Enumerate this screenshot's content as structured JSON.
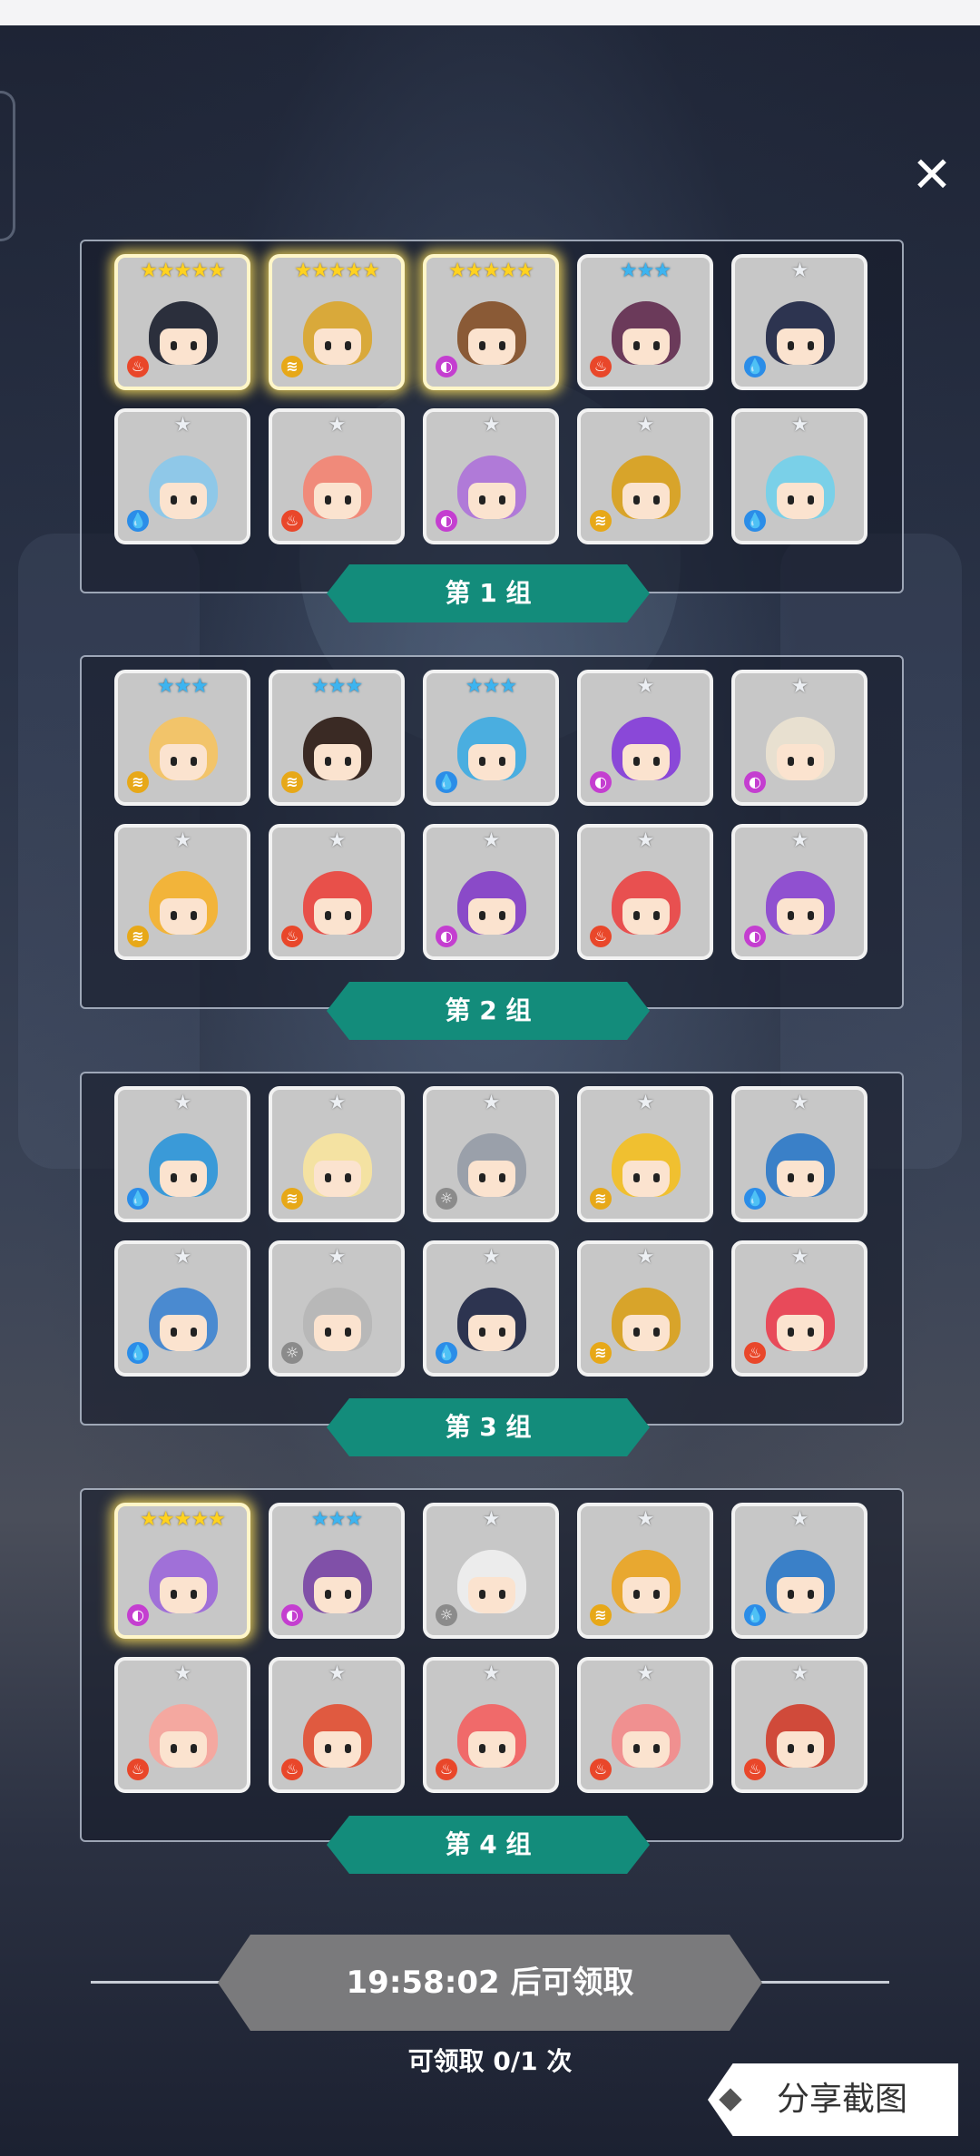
{
  "close_glyph": "✕",
  "groups": [
    {
      "label": "第 1 组",
      "cards": [
        {
          "stars": "★★★★★",
          "tier": "gold",
          "element": "fire",
          "hair": "#2b2f3c"
        },
        {
          "stars": "★★★★★",
          "tier": "gold",
          "element": "wind",
          "hair": "#d9a93a"
        },
        {
          "stars": "★★★★★",
          "tier": "gold",
          "element": "dark",
          "hair": "#8a5a36"
        },
        {
          "stars": "★★★",
          "tier": "blue",
          "element": "fire",
          "hair": "#6b3a5a"
        },
        {
          "stars": "★",
          "tier": "silver",
          "element": "water",
          "hair": "#2d3450"
        },
        {
          "stars": "★",
          "tier": "silver",
          "element": "water",
          "hair": "#8fc8e8"
        },
        {
          "stars": "★",
          "tier": "silver",
          "element": "fire",
          "hair": "#f08a7a"
        },
        {
          "stars": "★",
          "tier": "silver",
          "element": "dark",
          "hair": "#b07ad8"
        },
        {
          "stars": "★",
          "tier": "silver",
          "element": "wind",
          "hair": "#d8a42a"
        },
        {
          "stars": "★",
          "tier": "silver",
          "element": "water",
          "hair": "#7ad0e8"
        }
      ]
    },
    {
      "label": "第 2 组",
      "cards": [
        {
          "stars": "★★★",
          "tier": "blue",
          "element": "wind",
          "hair": "#f2c46a"
        },
        {
          "stars": "★★★",
          "tier": "blue",
          "element": "wind",
          "hair": "#3a2a24"
        },
        {
          "stars": "★★★",
          "tier": "blue",
          "element": "water",
          "hair": "#4aaee0"
        },
        {
          "stars": "★",
          "tier": "silver",
          "element": "dark",
          "hair": "#8a48d8"
        },
        {
          "stars": "★",
          "tier": "silver",
          "element": "dark",
          "hair": "#e8e0d0"
        },
        {
          "stars": "★",
          "tier": "silver",
          "element": "wind",
          "hair": "#f2b43a"
        },
        {
          "stars": "★",
          "tier": "silver",
          "element": "fire",
          "hair": "#e8504a"
        },
        {
          "stars": "★",
          "tier": "silver",
          "element": "dark",
          "hair": "#8a4ac8"
        },
        {
          "stars": "★",
          "tier": "silver",
          "element": "fire",
          "hair": "#e85050"
        },
        {
          "stars": "★",
          "tier": "silver",
          "element": "dark",
          "hair": "#9050d0"
        }
      ]
    },
    {
      "label": "第 3 组",
      "cards": [
        {
          "stars": "★",
          "tier": "silver",
          "element": "water",
          "hair": "#3a9ad8"
        },
        {
          "stars": "★",
          "tier": "silver",
          "element": "wind",
          "hair": "#f4e2a2"
        },
        {
          "stars": "★",
          "tier": "silver",
          "element": "light",
          "hair": "#9aa0aa"
        },
        {
          "stars": "★",
          "tier": "silver",
          "element": "wind",
          "hair": "#f0c030"
        },
        {
          "stars": "★",
          "tier": "silver",
          "element": "water",
          "hair": "#3a80c8"
        },
        {
          "stars": "★",
          "tier": "silver",
          "element": "water",
          "hair": "#4a8ad0"
        },
        {
          "stars": "★",
          "tier": "silver",
          "element": "light",
          "hair": "#b8b8b8"
        },
        {
          "stars": "★",
          "tier": "silver",
          "element": "water",
          "hair": "#2d3450"
        },
        {
          "stars": "★",
          "tier": "silver",
          "element": "wind",
          "hair": "#d8a42a"
        },
        {
          "stars": "★",
          "tier": "silver",
          "element": "fire",
          "hair": "#e84a5a"
        }
      ]
    },
    {
      "label": "第 4 组",
      "cards": [
        {
          "stars": "★★★★★",
          "tier": "gold",
          "element": "dark",
          "hair": "#a070d8"
        },
        {
          "stars": "★★★",
          "tier": "blue",
          "element": "dark",
          "hair": "#8050a8"
        },
        {
          "stars": "★",
          "tier": "silver",
          "element": "light",
          "hair": "#ececec"
        },
        {
          "stars": "★",
          "tier": "silver",
          "element": "wind",
          "hair": "#e8a830"
        },
        {
          "stars": "★",
          "tier": "silver",
          "element": "water",
          "hair": "#3a80c8"
        },
        {
          "stars": "★",
          "tier": "silver",
          "element": "fire",
          "hair": "#f4a8a0"
        },
        {
          "stars": "★",
          "tier": "silver",
          "element": "fire",
          "hair": "#e05a40"
        },
        {
          "stars": "★",
          "tier": "silver",
          "element": "fire",
          "hair": "#f06a6a"
        },
        {
          "stars": "★",
          "tier": "silver",
          "element": "fire",
          "hair": "#f09090"
        },
        {
          "stars": "★",
          "tier": "silver",
          "element": "fire",
          "hair": "#d04a3a"
        }
      ]
    }
  ],
  "timer_text": "19:58:02 后可领取",
  "claim_count": "可领取 0/1 次",
  "share_label": "分享截图",
  "element_glyphs": {
    "fire": "♨",
    "water": "💧",
    "dark": "◐",
    "wind": "≋",
    "light": "☼"
  }
}
